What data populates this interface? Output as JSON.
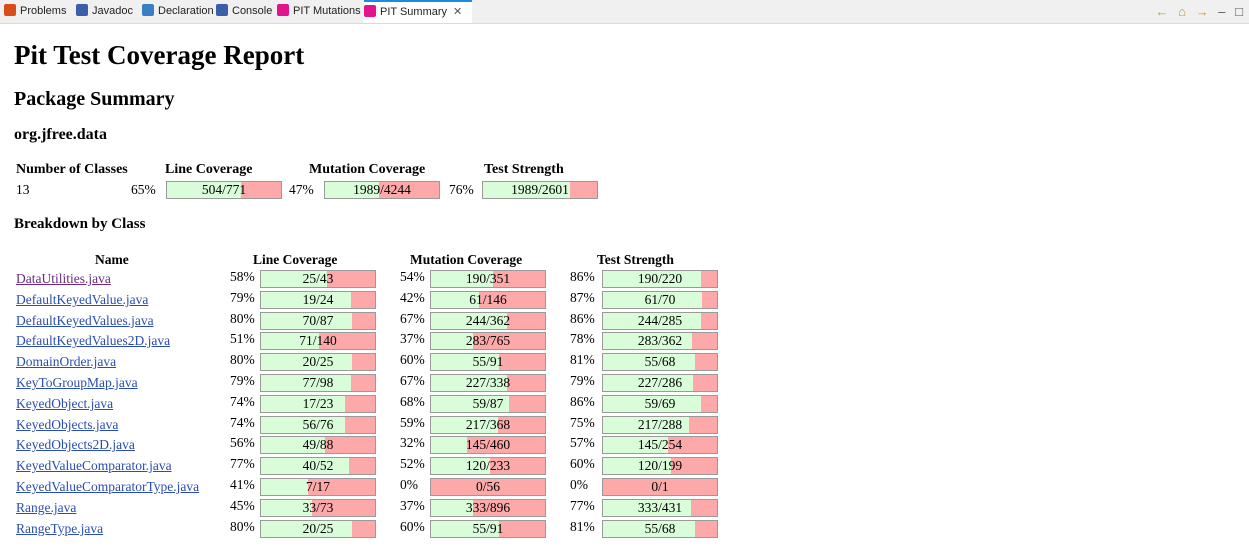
{
  "tabs": [
    {
      "label": "Problems",
      "icon": "problems-icon",
      "color": "#d94c1a"
    },
    {
      "label": "Javadoc",
      "icon": "javadoc-icon",
      "color": "#3a5fa8"
    },
    {
      "label": "Declaration",
      "icon": "declaration-icon",
      "color": "#3a7fc4"
    },
    {
      "label": "Console",
      "icon": "console-icon",
      "color": "#3a5fa8"
    },
    {
      "label": "PIT Mutations",
      "icon": "pit-icon",
      "color": "#e0148c"
    },
    {
      "label": "PIT Summary",
      "icon": "pit-icon",
      "color": "#e0148c",
      "active": true
    }
  ],
  "toolbar": {
    "back": "back-icon",
    "home": "home-icon",
    "forward": "forward-icon",
    "minimize": "minimize-icon",
    "maximize": "maximize-icon"
  },
  "report": {
    "title": "Pit Test Coverage Report",
    "package_summary": "Package Summary",
    "package_name": "org.jfree.data",
    "breakdown": "Breakdown by Class"
  },
  "summary": {
    "headers": {
      "classes": "Number of Classes",
      "line": "Line Coverage",
      "mutation": "Mutation Coverage",
      "strength": "Test Strength"
    },
    "num_classes": "13",
    "line": {
      "pct": "65%",
      "label": "504/771",
      "fraction": 0.65
    },
    "mutation": {
      "pct": "47%",
      "label": "1989/4244",
      "fraction": 0.47
    },
    "strength": {
      "pct": "76%",
      "label": "1989/2601",
      "fraction": 0.76
    }
  },
  "breakdown_headers": {
    "name": "Name",
    "line": "Line Coverage",
    "mutation": "Mutation Coverage",
    "strength": "Test Strength"
  },
  "classes": [
    {
      "name": "DataUtilities.java",
      "visited": true,
      "line_pct": "58%",
      "line": "25/43",
      "line_f": 0.58,
      "mut_pct": "54%",
      "mut": "190/351",
      "mut_f": 0.54,
      "str_pct": "86%",
      "str": "190/220",
      "str_f": 0.86
    },
    {
      "name": "DefaultKeyedValue.java",
      "line_pct": "79%",
      "line": "19/24",
      "line_f": 0.79,
      "mut_pct": "42%",
      "mut": "61/146",
      "mut_f": 0.42,
      "str_pct": "87%",
      "str": "61/70",
      "str_f": 0.87
    },
    {
      "name": "DefaultKeyedValues.java",
      "line_pct": "80%",
      "line": "70/87",
      "line_f": 0.8,
      "mut_pct": "67%",
      "mut": "244/362",
      "mut_f": 0.67,
      "str_pct": "86%",
      "str": "244/285",
      "str_f": 0.86
    },
    {
      "name": "DefaultKeyedValues2D.java",
      "line_pct": "51%",
      "line": "71/140",
      "line_f": 0.51,
      "mut_pct": "37%",
      "mut": "283/765",
      "mut_f": 0.37,
      "str_pct": "78%",
      "str": "283/362",
      "str_f": 0.78
    },
    {
      "name": "DomainOrder.java",
      "line_pct": "80%",
      "line": "20/25",
      "line_f": 0.8,
      "mut_pct": "60%",
      "mut": "55/91",
      "mut_f": 0.6,
      "str_pct": "81%",
      "str": "55/68",
      "str_f": 0.81
    },
    {
      "name": "KeyToGroupMap.java",
      "line_pct": "79%",
      "line": "77/98",
      "line_f": 0.79,
      "mut_pct": "67%",
      "mut": "227/338",
      "mut_f": 0.67,
      "str_pct": "79%",
      "str": "227/286",
      "str_f": 0.79
    },
    {
      "name": "KeyedObject.java",
      "line_pct": "74%",
      "line": "17/23",
      "line_f": 0.74,
      "mut_pct": "68%",
      "mut": "59/87",
      "mut_f": 0.68,
      "str_pct": "86%",
      "str": "59/69",
      "str_f": 0.86
    },
    {
      "name": "KeyedObjects.java",
      "line_pct": "74%",
      "line": "56/76",
      "line_f": 0.74,
      "mut_pct": "59%",
      "mut": "217/368",
      "mut_f": 0.59,
      "str_pct": "75%",
      "str": "217/288",
      "str_f": 0.75
    },
    {
      "name": "KeyedObjects2D.java",
      "line_pct": "56%",
      "line": "49/88",
      "line_f": 0.56,
      "mut_pct": "32%",
      "mut": "145/460",
      "mut_f": 0.32,
      "str_pct": "57%",
      "str": "145/254",
      "str_f": 0.57
    },
    {
      "name": "KeyedValueComparator.java",
      "line_pct": "77%",
      "line": "40/52",
      "line_f": 0.77,
      "mut_pct": "52%",
      "mut": "120/233",
      "mut_f": 0.52,
      "str_pct": "60%",
      "str": "120/199",
      "str_f": 0.6
    },
    {
      "name": "KeyedValueComparatorType.java",
      "line_pct": "41%",
      "line": "7/17",
      "line_f": 0.41,
      "mut_pct": "0%",
      "mut": "0/56",
      "mut_f": 0.0,
      "str_pct": "0%",
      "str": "0/1",
      "str_f": 0.0
    },
    {
      "name": "Range.java",
      "line_pct": "45%",
      "line": "33/73",
      "line_f": 0.45,
      "mut_pct": "37%",
      "mut": "333/896",
      "mut_f": 0.37,
      "str_pct": "77%",
      "str": "333/431",
      "str_f": 0.77
    },
    {
      "name": "RangeType.java",
      "line_pct": "80%",
      "line": "20/25",
      "line_f": 0.8,
      "mut_pct": "60%",
      "mut": "55/91",
      "mut_f": 0.6,
      "str_pct": "81%",
      "str": "55/68",
      "str_f": 0.81
    }
  ]
}
